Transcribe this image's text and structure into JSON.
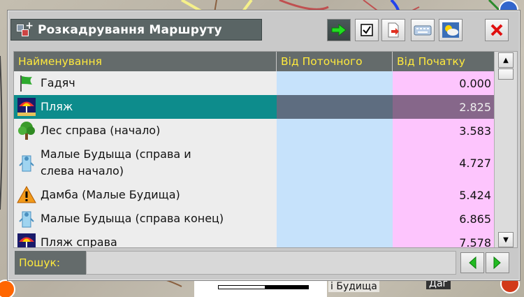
{
  "dialog": {
    "title": "Розкадрування Маршруту",
    "icon": "route-layout-icon"
  },
  "toolbar": {
    "buttons": [
      {
        "icon": "green-arrow-right-icon"
      },
      {
        "icon": "checkbox-checked-icon"
      },
      {
        "icon": "document-export-icon"
      },
      {
        "icon": "keyboard-icon"
      },
      {
        "icon": "weather-icon"
      },
      {
        "icon": "close-x-icon"
      }
    ]
  },
  "table": {
    "columns": [
      "Найменування",
      "Від Поточного",
      "Від Початку"
    ],
    "rows": [
      {
        "icon": "green-flag-icon",
        "name": "Гадяч",
        "from_current": "",
        "from_start": "0.000",
        "selected": false
      },
      {
        "icon": "beach-umbrella-icon",
        "name": "Пляж",
        "from_current": "",
        "from_start": "2.825",
        "selected": true
      },
      {
        "icon": "tree-icon",
        "name": "Лес справа (начало)",
        "from_current": "",
        "from_start": "3.583",
        "selected": false
      },
      {
        "icon": "water-tap-icon",
        "name": "Малые Будыща (справа и\nслева начало)",
        "from_current": "",
        "from_start": "4.727",
        "selected": false
      },
      {
        "icon": "warning-triangle-icon",
        "name": "Дамба (Малые Будища)",
        "from_current": "",
        "from_start": "5.424",
        "selected": false
      },
      {
        "icon": "water-tap-icon",
        "name": "Малые Будыща (справа конец)",
        "from_current": "",
        "from_start": "6.865",
        "selected": false
      },
      {
        "icon": "beach-umbrella-icon",
        "name": "Пляж справа",
        "from_current": "",
        "from_start": "7.578",
        "selected": false
      }
    ]
  },
  "search": {
    "label": "Пошук:",
    "value": "",
    "placeholder": ""
  },
  "map": {
    "town_label": "і Будища",
    "tag_label": "Даг"
  },
  "colors": {
    "header_bg": "#646b6b",
    "header_text": "#ffea3d",
    "selected_row": "#0d8c8c",
    "col_current_bg": "#c6e2fb",
    "col_start_bg": "#fdc5fd"
  }
}
